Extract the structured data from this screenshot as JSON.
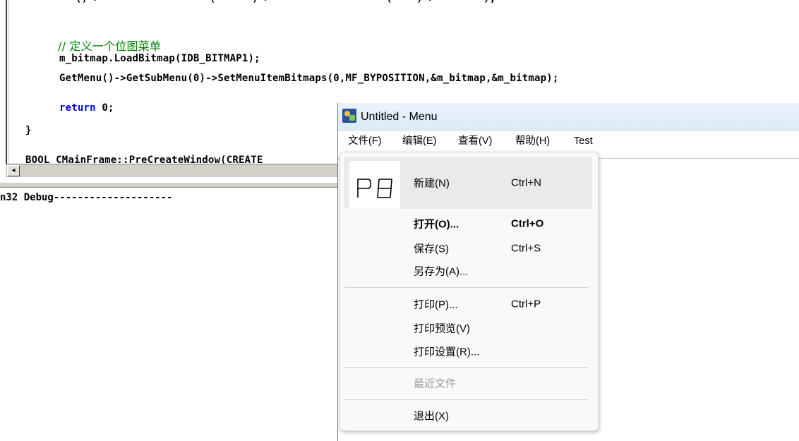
{
  "editor": {
    "code_comment": "// 定义一个位图菜单",
    "code_load": "m_bitmap.LoadBitmap(IDB_BITMAP1);",
    "code_setbitmaps": "GetMenu()->GetSubMenu(0)->SetMenuItemBitmaps(0,MF_BYPOSITION,&m_bitmap,&m_bitmap);",
    "code_return_kw": "return",
    "code_return_val": " 0;",
    "code_brace": "}",
    "code_partial": "BOOL CMainFrame::PreCreateWindow(CREATE",
    "code_top_partial": "        ()->                  (      )->                   (    )->        );"
  },
  "output": {
    "text": "n32 Debug--------------------"
  },
  "window": {
    "title": "Untitled - Menu",
    "menubar": [
      "文件(F)",
      "编辑(E)",
      "查看(V)",
      "帮助(H)",
      "Test"
    ]
  },
  "file_menu": {
    "items": [
      {
        "label": "新建(N)",
        "accel": "Ctrl+N"
      },
      {
        "label": "打开(O)...",
        "accel": "Ctrl+O"
      },
      {
        "label": "保存(S)",
        "accel": "Ctrl+S"
      },
      {
        "label": "另存为(A)...",
        "accel": ""
      },
      {
        "label": "打印(P)...",
        "accel": "Ctrl+P"
      },
      {
        "label": "打印预览(V)",
        "accel": ""
      },
      {
        "label": "打印设置(R)...",
        "accel": ""
      },
      {
        "label": "最近文件",
        "accel": ""
      },
      {
        "label": "退出(X)",
        "accel": ""
      }
    ]
  },
  "colors": {
    "keyword": "#0000ff",
    "comment": "#008000",
    "highlight": "#eaeaea",
    "disabled_text": "#9a9a9a"
  },
  "icons": {
    "app": "mfc-app-icon",
    "menu_bitmap": "bitmap-glyph-icon",
    "scroll_left": "scroll-left-arrow-icon"
  }
}
